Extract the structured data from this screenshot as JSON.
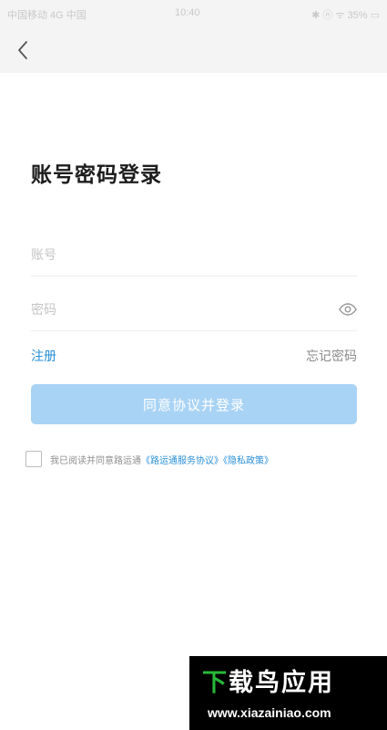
{
  "status_bar": {
    "carrier": "中国移动 4G 中国",
    "time": "10:40",
    "indicators": "✱ ⓝ ᯤ 35% ▭"
  },
  "nav": {
    "back_icon": "chevron-left-icon"
  },
  "page": {
    "title": "账号密码登录"
  },
  "form": {
    "account_placeholder": "账号",
    "password_placeholder": "密码",
    "eye_icon": "eye-icon"
  },
  "links": {
    "register": "注册",
    "forgot": "忘记密码"
  },
  "login_button": {
    "label": "同意协议并登录"
  },
  "agreement": {
    "prefix": "我已阅读并同意路运通",
    "terms": "《路运通服务协议》",
    "privacy": "《隐私政策》",
    "checked": false
  },
  "watermark": {
    "title": "下载鸟应用",
    "url": "www.xiazainiao.com"
  },
  "colors": {
    "accent": "#2a8fd8",
    "button_disabled": "#a9d3f5",
    "header_bg": "#f4f4f4",
    "watermark_green": "#28b93a"
  }
}
